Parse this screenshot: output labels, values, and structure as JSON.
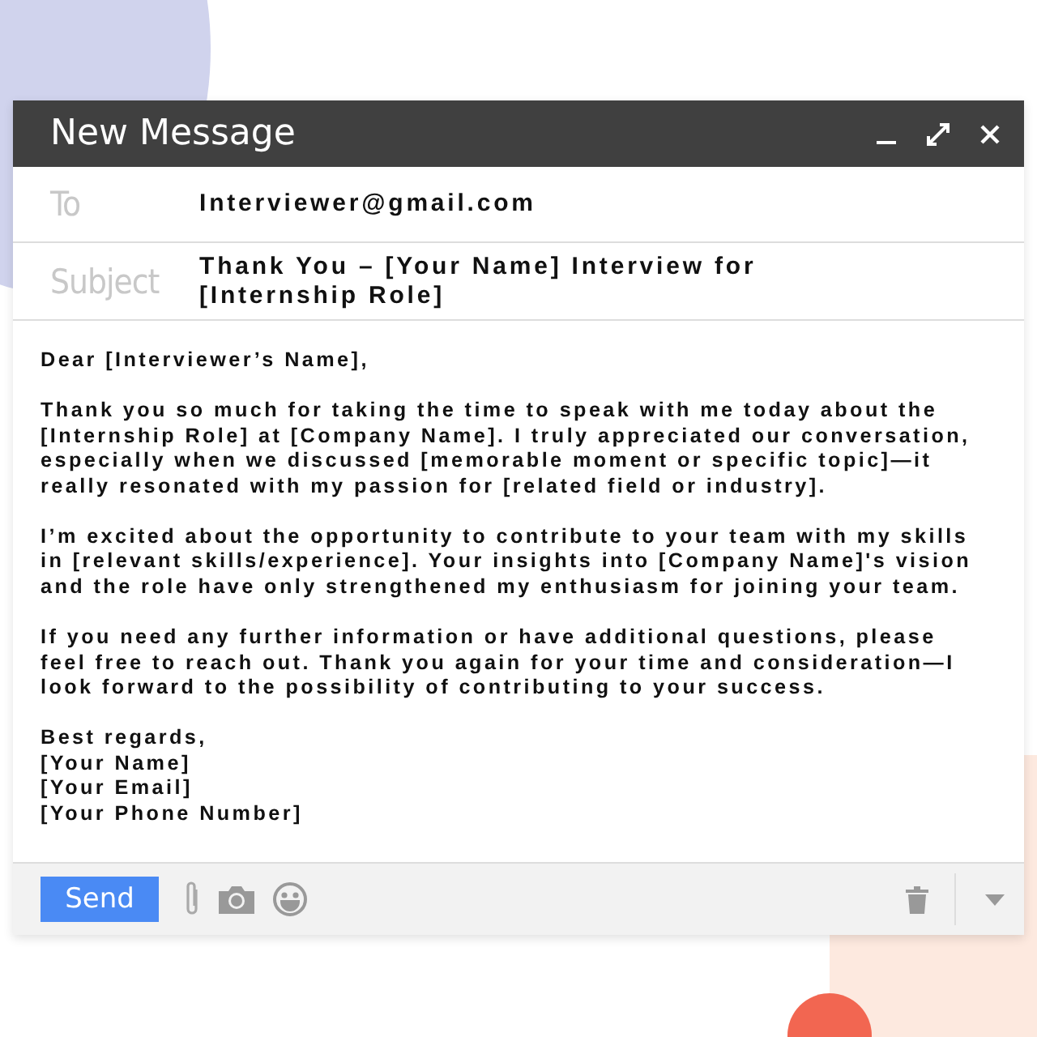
{
  "window": {
    "title": "New Message"
  },
  "to": {
    "label": "To",
    "value": "Interviewer@gmail.com"
  },
  "subject": {
    "label": "Subject",
    "value": "Thank You – [Your Name] Interview for\n[Internship Role]"
  },
  "body": {
    "paragraphs": [
      "Dear [Interviewer’s Name],",
      "Thank you so much for taking the time to speak with me today about the\n[Internship Role] at [Company Name]. I truly appreciated our conversation,\nespecially when we discussed [memorable moment or specific topic]—it\nreally resonated with my passion for [related field or industry].",
      "I’m excited about the opportunity to contribute to your team with my skills\nin [relevant skills/experience]. Your insights into [Company Name]'s vision\nand the role have only strengthened my enthusiasm for joining your team.",
      "If you need any further information or have additional questions, please\nfeel free to reach out. Thank you again for your time and consideration—I\nlook forward to the possibility of contributing to your success.",
      "Best regards,\n[Your Name]\n[Your Email]\n[Your Phone Number]"
    ]
  },
  "toolbar": {
    "send": "Send"
  }
}
